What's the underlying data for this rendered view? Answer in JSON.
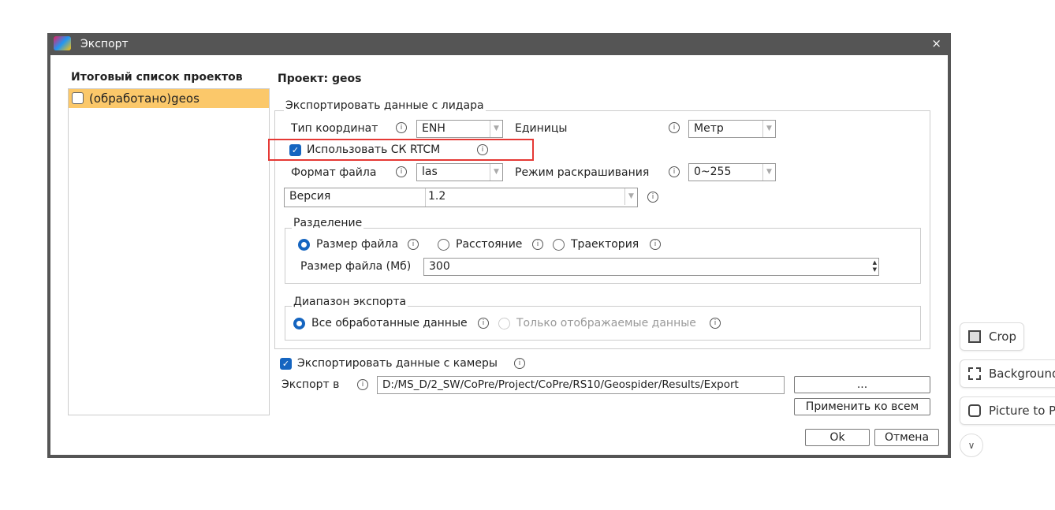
{
  "window": {
    "title": "Экспорт",
    "close": "×"
  },
  "left": {
    "heading": "Итоговый список проектов",
    "items": [
      {
        "label": "(обработано)geos",
        "checked": false
      }
    ]
  },
  "project": {
    "heading": "Проект: geos"
  },
  "lidar": {
    "group": "Экспортировать данные с лидара",
    "coord_label": "Тип координат",
    "coord_value": "ENH",
    "units_label": "Единицы",
    "units_value": "Метр",
    "rtcm_label": "Использовать СК RTCM",
    "rtcm_checked": true,
    "format_label": "Формат файла",
    "format_value": "las",
    "color_label": "Режим раскрашивания",
    "color_value": "0~255",
    "version_label": "Версия",
    "version_value": "1.2"
  },
  "split": {
    "group": "Разделение",
    "opt1": "Размер файла",
    "opt2": "Расстояние",
    "opt3": "Траектория",
    "selected": "Размер файла",
    "size_label": "Размер файла (Мб)",
    "size_value": "300"
  },
  "range": {
    "group": "Диапазон экспорта",
    "opt1": "Все обработанные данные",
    "opt2": "Только отображаемые данные"
  },
  "camera": {
    "label": "Экспортировать данные с камеры",
    "checked": true
  },
  "export": {
    "label": "Экспорт в",
    "path": "D:/MS_D/2_SW/CoPre/Project/CoPre/RS10/Geospider/Results/Export",
    "browse": "...",
    "apply_all": "Применить ко всем"
  },
  "buttons": {
    "ok": "Ok",
    "cancel": "Отмена"
  },
  "side_tools": {
    "crop": "Crop",
    "background": "Background",
    "picture": "Picture to PI"
  },
  "highlight_color": "#e53935"
}
